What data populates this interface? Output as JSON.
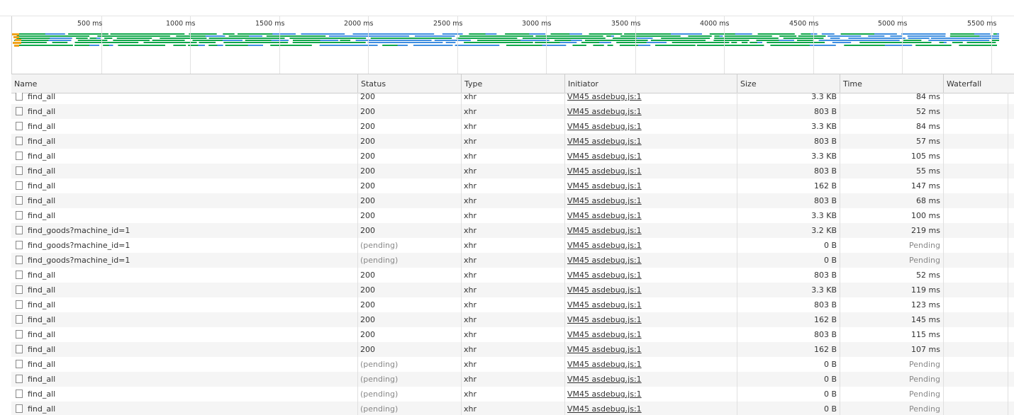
{
  "timeline": {
    "ticks": [
      "500 ms",
      "1000 ms",
      "1500 ms",
      "2000 ms",
      "2500 ms",
      "3000 ms",
      "3500 ms",
      "4000 ms",
      "4500 ms",
      "5000 ms",
      "5500 ms"
    ],
    "colors": {
      "waiting": "#0fa74a",
      "download": "#3e8ee0",
      "start": "#f0a21a",
      "queue": "#cccccc"
    }
  },
  "columns": {
    "name": "Name",
    "status": "Status",
    "type": "Type",
    "initiator": "Initiator",
    "size": "Size",
    "time": "Time",
    "waterfall": "Waterfall"
  },
  "rows": [
    {
      "name": "find_all",
      "status": "200",
      "type": "xhr",
      "initiator": "VM45 asdebug.js:1",
      "size": "3.3 KB",
      "time": "84 ms"
    },
    {
      "name": "find_all",
      "status": "200",
      "type": "xhr",
      "initiator": "VM45 asdebug.js:1",
      "size": "803 B",
      "time": "52 ms"
    },
    {
      "name": "find_all",
      "status": "200",
      "type": "xhr",
      "initiator": "VM45 asdebug.js:1",
      "size": "3.3 KB",
      "time": "84 ms"
    },
    {
      "name": "find_all",
      "status": "200",
      "type": "xhr",
      "initiator": "VM45 asdebug.js:1",
      "size": "803 B",
      "time": "57 ms"
    },
    {
      "name": "find_all",
      "status": "200",
      "type": "xhr",
      "initiator": "VM45 asdebug.js:1",
      "size": "3.3 KB",
      "time": "105 ms"
    },
    {
      "name": "find_all",
      "status": "200",
      "type": "xhr",
      "initiator": "VM45 asdebug.js:1",
      "size": "803 B",
      "time": "55 ms"
    },
    {
      "name": "find_all",
      "status": "200",
      "type": "xhr",
      "initiator": "VM45 asdebug.js:1",
      "size": "162 B",
      "time": "147 ms"
    },
    {
      "name": "find_all",
      "status": "200",
      "type": "xhr",
      "initiator": "VM45 asdebug.js:1",
      "size": "803 B",
      "time": "68 ms"
    },
    {
      "name": "find_all",
      "status": "200",
      "type": "xhr",
      "initiator": "VM45 asdebug.js:1",
      "size": "3.3 KB",
      "time": "100 ms"
    },
    {
      "name": "find_goods?machine_id=1",
      "status": "200",
      "type": "xhr",
      "initiator": "VM45 asdebug.js:1",
      "size": "3.2 KB",
      "time": "219 ms"
    },
    {
      "name": "find_goods?machine_id=1",
      "status": "(pending)",
      "type": "xhr",
      "initiator": "VM45 asdebug.js:1",
      "size": "0 B",
      "time": "Pending"
    },
    {
      "name": "find_goods?machine_id=1",
      "status": "(pending)",
      "type": "xhr",
      "initiator": "VM45 asdebug.js:1",
      "size": "0 B",
      "time": "Pending"
    },
    {
      "name": "find_all",
      "status": "200",
      "type": "xhr",
      "initiator": "VM45 asdebug.js:1",
      "size": "803 B",
      "time": "52 ms"
    },
    {
      "name": "find_all",
      "status": "200",
      "type": "xhr",
      "initiator": "VM45 asdebug.js:1",
      "size": "3.3 KB",
      "time": "119 ms"
    },
    {
      "name": "find_all",
      "status": "200",
      "type": "xhr",
      "initiator": "VM45 asdebug.js:1",
      "size": "803 B",
      "time": "123 ms"
    },
    {
      "name": "find_all",
      "status": "200",
      "type": "xhr",
      "initiator": "VM45 asdebug.js:1",
      "size": "162 B",
      "time": "145 ms"
    },
    {
      "name": "find_all",
      "status": "200",
      "type": "xhr",
      "initiator": "VM45 asdebug.js:1",
      "size": "803 B",
      "time": "115 ms"
    },
    {
      "name": "find_all",
      "status": "200",
      "type": "xhr",
      "initiator": "VM45 asdebug.js:1",
      "size": "162 B",
      "time": "107 ms"
    },
    {
      "name": "find_all",
      "status": "(pending)",
      "type": "xhr",
      "initiator": "VM45 asdebug.js:1",
      "size": "0 B",
      "time": "Pending"
    },
    {
      "name": "find_all",
      "status": "(pending)",
      "type": "xhr",
      "initiator": "VM45 asdebug.js:1",
      "size": "0 B",
      "time": "Pending"
    },
    {
      "name": "find_all",
      "status": "(pending)",
      "type": "xhr",
      "initiator": "VM45 asdebug.js:1",
      "size": "0 B",
      "time": "Pending"
    },
    {
      "name": "find_all",
      "status": "(pending)",
      "type": "xhr",
      "initiator": "VM45 asdebug.js:1",
      "size": "0 B",
      "time": "Pending"
    }
  ]
}
